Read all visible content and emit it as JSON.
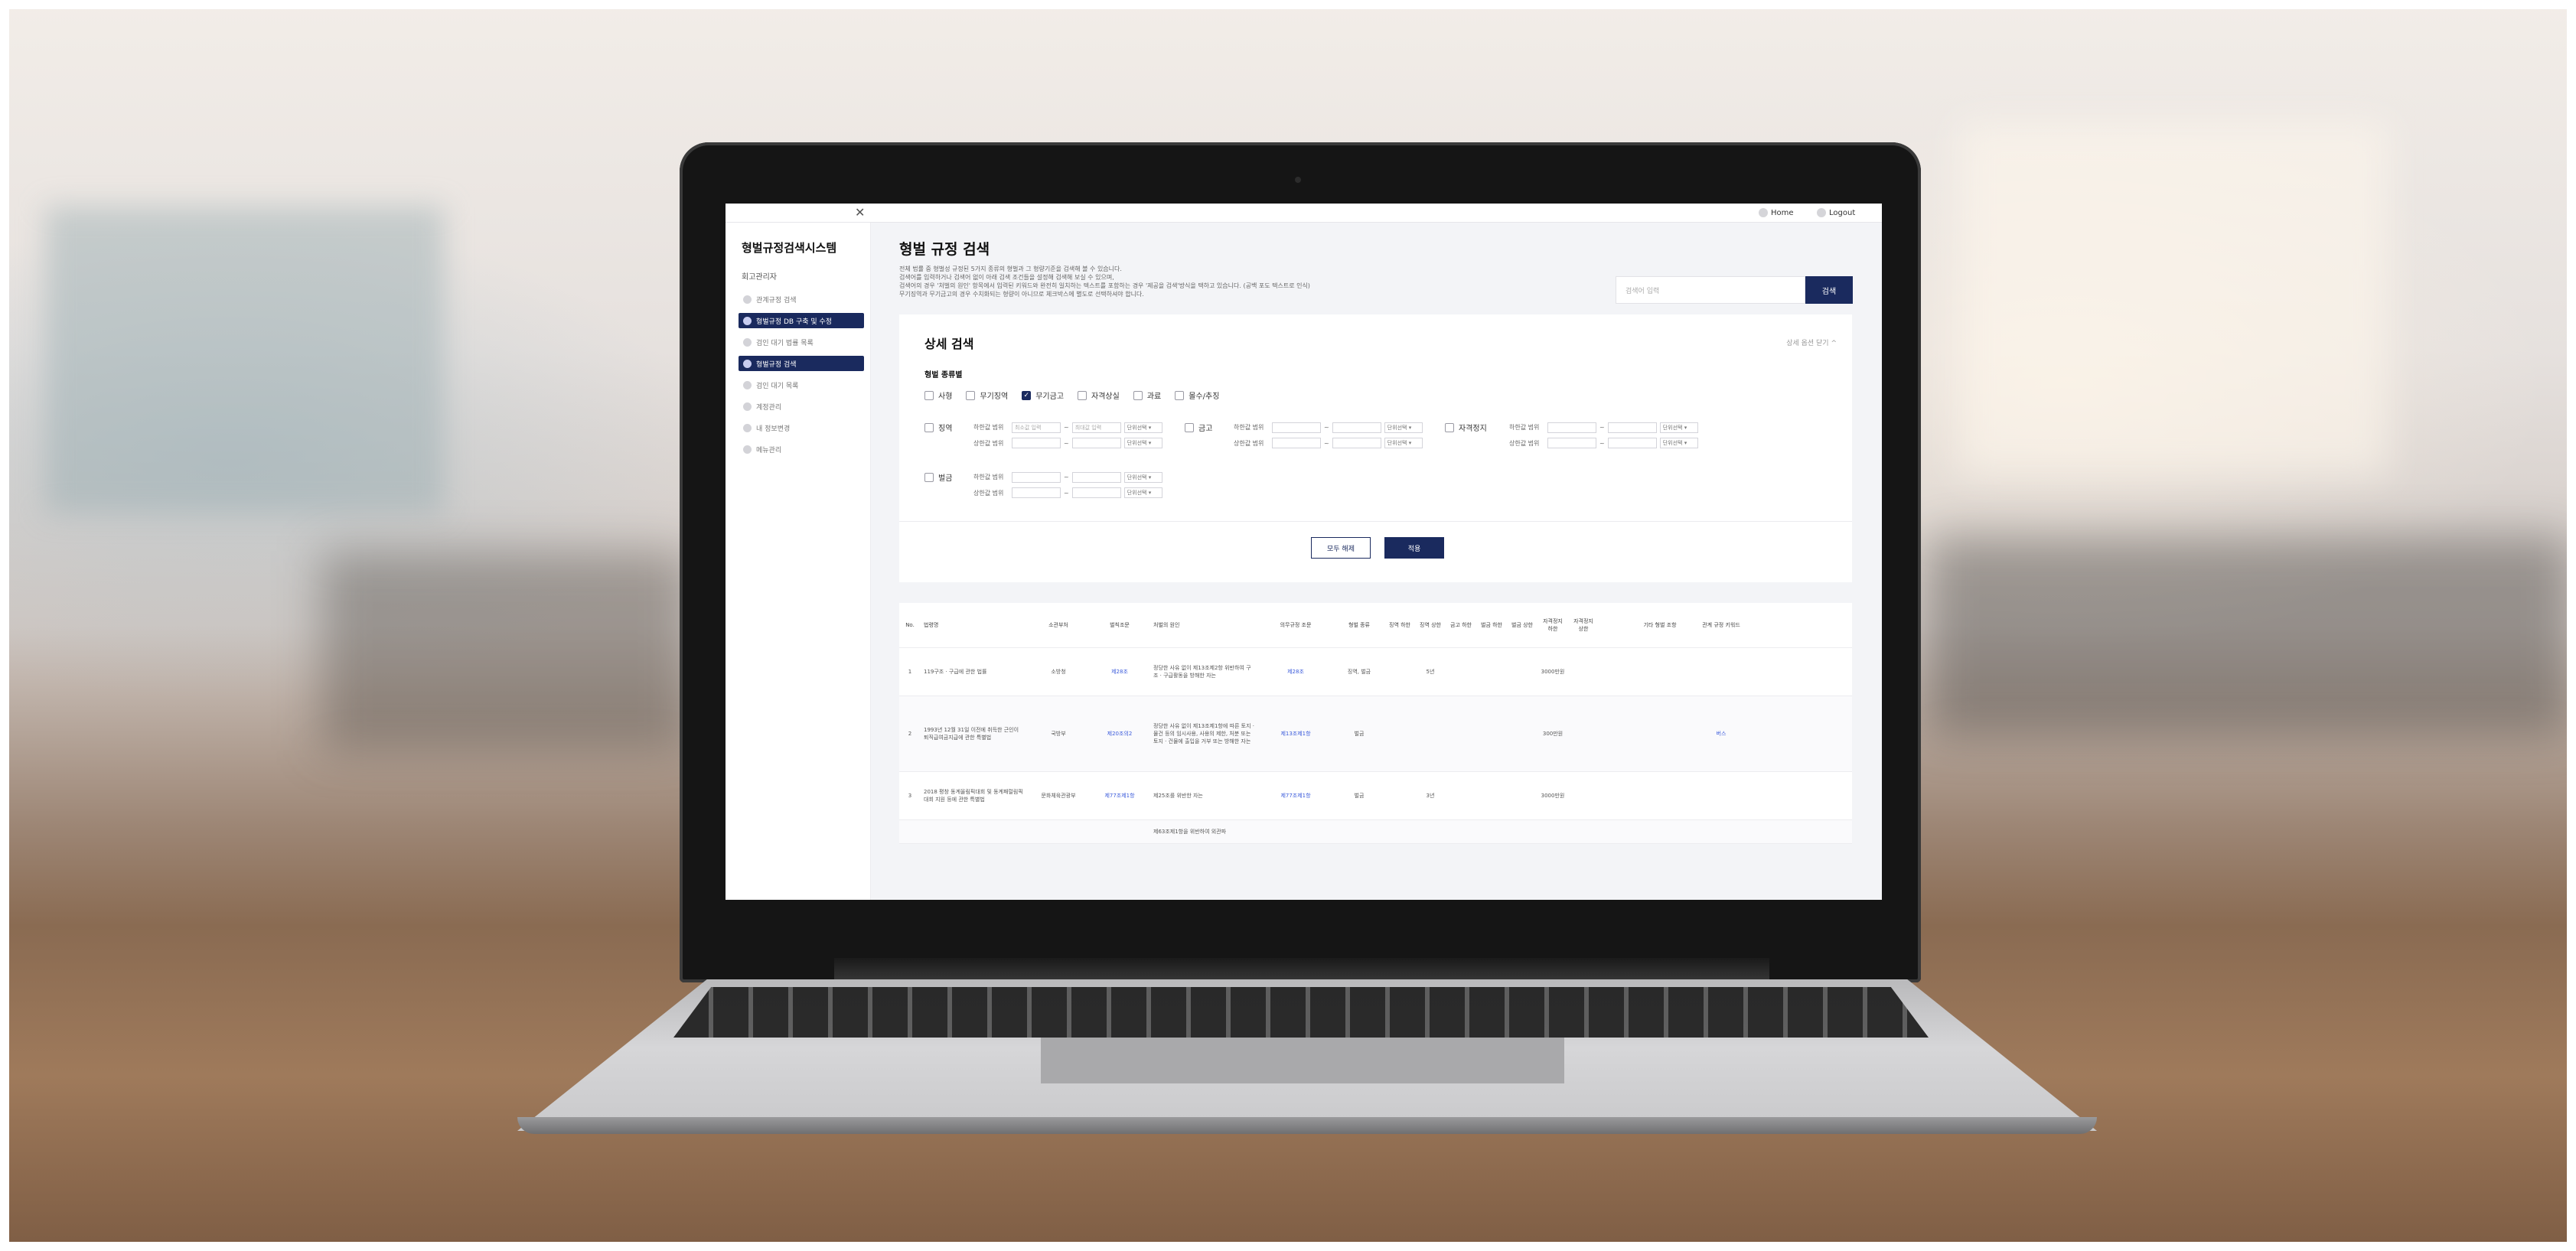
{
  "topbar": {
    "home": "Home",
    "logout": "Logout"
  },
  "sidebar": {
    "title": "형벌규정검색시스템",
    "section": "회고관리자",
    "items": [
      {
        "label": "관계규정 검색",
        "active": false
      },
      {
        "label": "형벌규정 DB 구축 및 수정",
        "active": true
      },
      {
        "label": "검인 대기 법률 목록",
        "active": false
      },
      {
        "label": "형벌규정 검색",
        "active": true
      },
      {
        "label": "검인 대기 목록",
        "active": false
      },
      {
        "label": "계정관리",
        "active": false
      },
      {
        "label": "내 정보변경",
        "active": false
      },
      {
        "label": "메뉴관리",
        "active": false
      }
    ]
  },
  "main": {
    "title": "형벌 규정 검색",
    "description": [
      "전체 법률 중 형벌성 규정된 5가지 종류의 형벌과 그 형량기준을 검색해 볼 수 있습니다.",
      "검색어를 입력하거나 검색어 없이 아래 검색 조건들을 설정해 검색해 보실 수 있으며,",
      "검색어의 경우 '처벌의 원인' 항목에서 입력된 키워드와 완전히 일치하는 텍스트를 포함하는 경우 '제공을 검색'방식을 택하고 있습니다. (공백 포도 텍스트로 인식)",
      "무기징역과 무기금고의 경우 수치화되는 형량이 아니므로 체크박스에 별도로 선택하셔야 합니다."
    ],
    "search": {
      "placeholder": "검색어 입력",
      "button": "검색"
    }
  },
  "detail": {
    "title": "상세 검색",
    "toggle": "상세 옵션 닫기 ^",
    "group": "형벌 종류별",
    "types": [
      {
        "label": "사형",
        "checked": false
      },
      {
        "label": "무기징역",
        "checked": false
      },
      {
        "label": "무기금고",
        "checked": true
      },
      {
        "label": "자격상실",
        "checked": false
      },
      {
        "label": "과료",
        "checked": false
      },
      {
        "label": "몰수/추징",
        "checked": false
      }
    ],
    "ranges": [
      {
        "label": "징역",
        "min_label": "하한값 범위",
        "max_label": "상한값 범위",
        "min_ph": "최소값 입력",
        "max_ph": "최대값 입력",
        "unit": "단위선택 ▾"
      },
      {
        "label": "금고",
        "min_label": "하한값 범위",
        "max_label": "상한값 범위",
        "min_ph": "",
        "max_ph": "",
        "unit": "단위선택 ▾"
      },
      {
        "label": "자격정지",
        "min_label": "하한값 범위",
        "max_label": "상한값 범위",
        "min_ph": "",
        "max_ph": "",
        "unit": "단위선택 ▾"
      },
      {
        "label": "벌금",
        "min_label": "하한값 범위",
        "max_label": "상한값 범위",
        "min_ph": "",
        "max_ph": "",
        "unit": "단위선택 ▾"
      }
    ],
    "reset": "모두 해제",
    "apply": "적용"
  },
  "table": {
    "headers": [
      "No.",
      "법령명",
      "소관부처",
      "벌칙조문",
      "처벌의 원인",
      "의무규정 조문",
      "형벌 종류",
      "징역 하한",
      "징역 상한",
      "금고 하한",
      "벌금 하한",
      "벌금 상한",
      "자격정지 하한",
      "자격정지 상한",
      "",
      "기타 형벌 조항",
      "관계 규정 키워드"
    ],
    "rows": [
      [
        "1",
        "119구조 · 구급에 관한 법률",
        "소방청",
        "제28조",
        "정당한 사유 없이 제13조제2항 위반하여 구조 · 구급활동을 방해한 자는",
        "제28조",
        "징역, 벌금",
        "",
        "5년",
        "",
        "",
        "",
        "3000만원",
        "",
        "",
        "",
        ""
      ],
      [
        "2",
        "1993년 12월 31일 이전에 취득한 근인이 퇴직급여금지급에 관한 특별법",
        "국방부",
        "제20조의2",
        "정당한 사유 없이 제13조제1항에 따른 토지 · 물건 등의 임시사용, 사용의 제한, 처분 또는 토지 · 건물에 출입을 거부 또는 방해한 자는",
        "제13조제1항",
        "벌금",
        "",
        "",
        "",
        "",
        "",
        "300만원",
        "",
        "",
        "",
        "버스"
      ],
      [
        "3",
        "2018 평창 동계올림픽대회 및 동계패럴림픽대회 지원 등에 관한 특별법",
        "문화체육관광부",
        "제77조제1항",
        "제25조를 위반한 자는",
        "제77조제1항",
        "벌금",
        "",
        "3년",
        "",
        "",
        "",
        "3000만원",
        "",
        "",
        "",
        ""
      ],
      [
        "",
        "",
        "",
        "",
        "제63조제1항을 위반하여 외관파",
        "",
        "",
        "",
        "",
        "",
        "",
        "",
        "",
        "",
        "",
        "",
        ""
      ]
    ]
  }
}
